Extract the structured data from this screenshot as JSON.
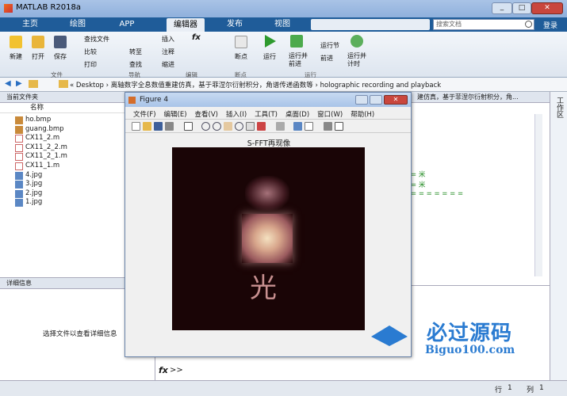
{
  "window": {
    "title": "MATLAB R2018a",
    "search_placeholder": "搜索文档",
    "login": "登录"
  },
  "tabs": [
    "主页",
    "绘图",
    "APP",
    "编辑器",
    "发布",
    "视图"
  ],
  "ribbon": {
    "file": {
      "new": "新建",
      "open": "打开",
      "save": "保存",
      "find_files": "查找文件",
      "compare": "比较",
      "print": "打印"
    },
    "nav": {
      "goto": "转至",
      "find": "查找"
    },
    "edit": {
      "insert": "插入",
      "comment": "注释",
      "indent": "缩进"
    },
    "breakpoints": {
      "label": "断点"
    },
    "run": {
      "run": "运行",
      "run_advance": "运行并\n前进",
      "run_section": "运行节",
      "advance": "前进",
      "run_time": "运行并\n计时"
    },
    "groups": [
      "文件",
      "导航",
      "编辑",
      "断点",
      "运行"
    ]
  },
  "address": {
    "path": "« Desktop › 离轴数字全息数值重建仿真，基于菲涅尔衍射积分，角谱传递函数等 › holographic recording and playback",
    "editor_path": "建仿真，基于菲涅尔衍射积分，角..."
  },
  "file_panel": {
    "title": "当前文件夹",
    "column": "名称",
    "files": [
      "ho.bmp",
      "guang.bmp",
      "CX11_2.m",
      "CX11_2_2.m",
      "CX11_2_1.m",
      "CX11_1.m",
      "4.jpg",
      "3.jpg",
      "2.jpg",
      "1.jpg"
    ]
  },
  "details": {
    "title": "详细信息",
    "hint": "选择文件以查看详细信息"
  },
  "figure": {
    "title": "Figure 4",
    "menu": [
      "文件(F)",
      "编辑(E)",
      "查看(V)",
      "插入(I)",
      "工具(T)",
      "桌面(D)",
      "窗口(W)",
      "帮助(H)"
    ],
    "plot_title": "S-FFT再现像",
    "char": "光"
  },
  "editor": {
    "snippet1": "= 米",
    "snippet2": "= 米",
    "snippet3": "= = = = = = ="
  },
  "workspace": {
    "title": "工作区"
  },
  "command": {
    "prompt": ">>"
  },
  "status": {
    "row_label": "行",
    "row": "1",
    "col_label": "列",
    "col": "1"
  },
  "watermark": {
    "name": "必过源码",
    "url": "Biguo100.com"
  },
  "colors": {
    "tabbar": "#1f5c99",
    "accent": "#2a7bd1"
  }
}
